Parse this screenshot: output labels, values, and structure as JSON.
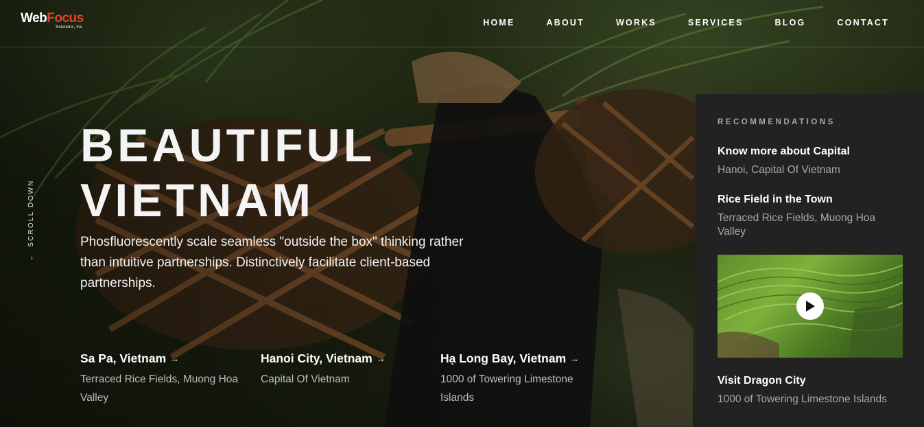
{
  "brand": {
    "name_part1": "Web",
    "name_part2": "Focus",
    "tagline": "Solutions, Inc."
  },
  "nav": {
    "items": [
      {
        "label": "HOME"
      },
      {
        "label": "ABOUT"
      },
      {
        "label": "WORKS"
      },
      {
        "label": "SERVICES"
      },
      {
        "label": "BLOG"
      },
      {
        "label": "CONTACT"
      }
    ]
  },
  "scroll": {
    "label": "SCROLL DOWN",
    "arrow": "←"
  },
  "hero": {
    "title_line1": "BEAUTIFUL",
    "title_line2": "VIETNAM",
    "text": "Phosfluorescently scale seamless \"outside the box\" thinking rather than intuitive partnerships. Distinctively facilitate client-based partnerships."
  },
  "destinations": [
    {
      "title": "Sa Pa, Vietnam",
      "subtitle": "Terraced Rice Fields, Muong Hoa Valley",
      "arrow": "→"
    },
    {
      "title": "Hanoi City, Vietnam",
      "subtitle": "Capital Of Vietnam",
      "arrow": "→"
    },
    {
      "title": "Hạ Long Bay, Vietnam",
      "subtitle": "1000 of Towering Limestone Islands",
      "arrow": "→"
    }
  ],
  "sidebar": {
    "heading": "RECOMMENDATIONS",
    "items": [
      {
        "title": "Know more about Capital",
        "subtitle": "Hanoi, Capital Of Vietnam"
      },
      {
        "title": "Rice Field in the Town",
        "subtitle": "Terraced Rice Fields, Muong Hoa Valley"
      },
      {
        "title": "Visit Dragon City",
        "subtitle": "1000 of Towering Limestone Islands"
      }
    ],
    "video": {
      "icon": "play-icon"
    }
  },
  "colors": {
    "accent": "#e0462a",
    "sidebar_bg": "#222222",
    "muted_text": "#a8a8a8"
  }
}
